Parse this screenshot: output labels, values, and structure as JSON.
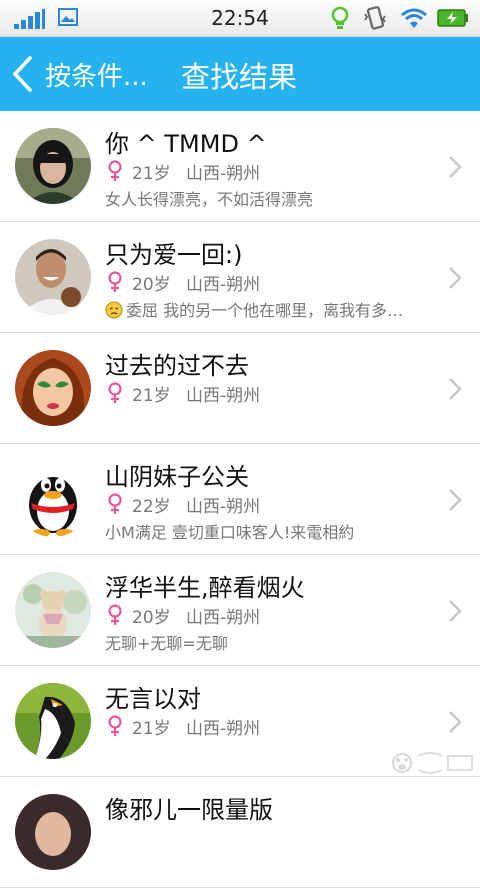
{
  "status_bar": {
    "time": "22:54",
    "icons": [
      "signal-icon",
      "photo-icon",
      "bulb-icon",
      "vibrate-icon",
      "wifi-icon",
      "battery-icon"
    ]
  },
  "header": {
    "back_label": "按条件...",
    "title": "查找结果",
    "background": "#25b2ef"
  },
  "results": [
    {
      "name": "你 ^ TMMD ^",
      "gender": "female",
      "age": "21岁",
      "location": "山西-朔州",
      "signature": "女人长得漂亮，不如活得漂亮",
      "emoji": null
    },
    {
      "name": "只为爱一回:)",
      "gender": "female",
      "age": "20岁",
      "location": "山西-朔州",
      "signature": "委屈 我的另一个他在哪里，离我有多…",
      "emoji": "aggrieved-emoji-icon"
    },
    {
      "name": "过去的过不去",
      "gender": "female",
      "age": "21岁",
      "location": "山西-朔州",
      "signature": "",
      "emoji": null
    },
    {
      "name": "山阴妹子公关",
      "gender": "female",
      "age": "22岁",
      "location": "山西-朔州",
      "signature": "小M满足 壹切重口味客人!来電相約",
      "emoji": null
    },
    {
      "name": "浮华半生,醉看烟火",
      "gender": "female",
      "age": "20岁",
      "location": "山西-朔州",
      "signature": "无聊+无聊=无聊",
      "emoji": null
    },
    {
      "name": "无言以对",
      "gender": "female",
      "age": "21岁",
      "location": "山西-朔州",
      "signature": "",
      "emoji": null
    },
    {
      "name": "像邪儿一限量版",
      "gender": "female",
      "age": "",
      "location": "",
      "signature": "",
      "emoji": null
    }
  ],
  "colors": {
    "accent": "#25b2ef",
    "female_icon": "#e8559a",
    "meta_text": "#777777"
  }
}
